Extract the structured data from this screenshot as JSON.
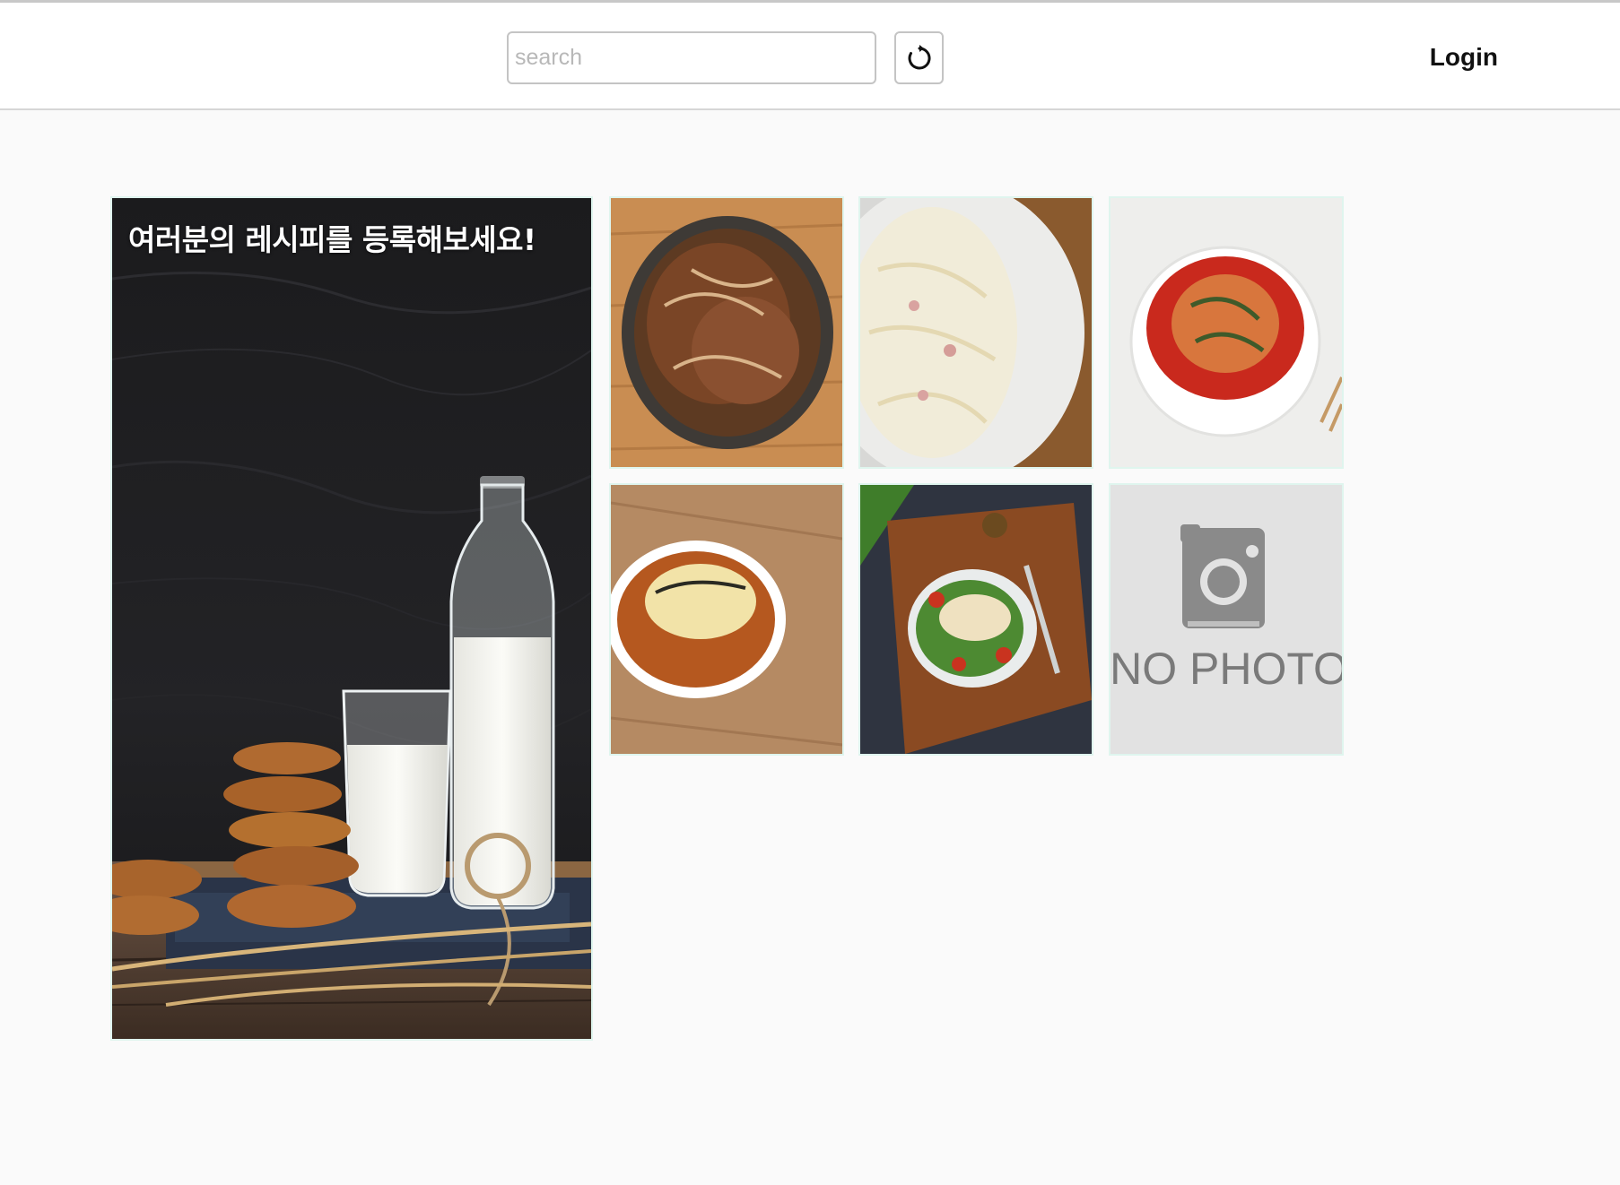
{
  "header": {
    "search_placeholder": "search",
    "search_value": "",
    "refresh_icon": "refresh-icon",
    "login_label": "Login"
  },
  "hero": {
    "title": "여러분의 레시피를 등록해보세요!"
  },
  "recipes": [
    {
      "image": "stir-fried-pork-photo"
    },
    {
      "image": "cream-pasta-photo"
    },
    {
      "image": "spicy-soup-bowl-photo"
    },
    {
      "image": "cheese-ramen-photo"
    },
    {
      "image": "chicken-salad-photo"
    },
    {
      "image": "no-photo-placeholder",
      "placeholder_text": "NO PHOTO"
    }
  ],
  "colors": {
    "background": "#fafafa",
    "header_bg": "#ffffff",
    "tile_border": "#dff5ee"
  }
}
